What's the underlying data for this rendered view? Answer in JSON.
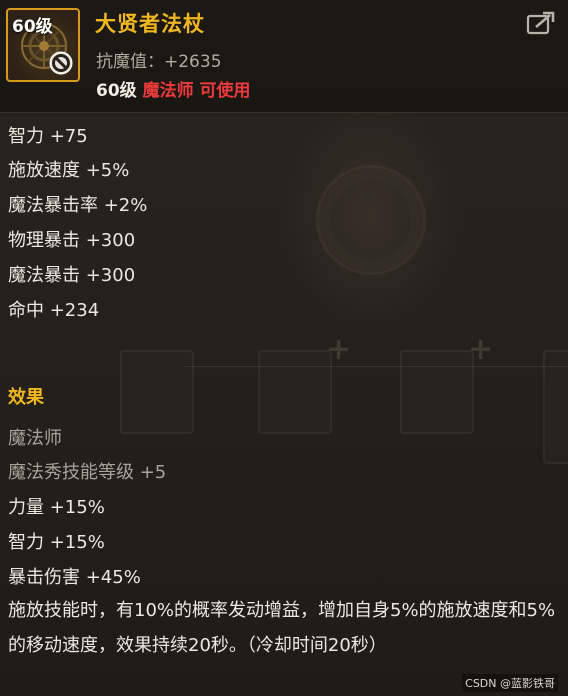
{
  "item": {
    "level_badge": "60级",
    "name": "大贤者法杖",
    "resist_label": "抗魔值：",
    "resist_value": "+2635",
    "req_level": "60级",
    "req_class": "魔法师 可使用"
  },
  "icons": {
    "share": "share-icon",
    "forbid": "forbid-icon"
  },
  "stats": [
    "智力 +75",
    "施放速度 +5%",
    "魔法暴击率 +2%",
    "物理暴击 +300",
    "魔法暴击 +300",
    "命中 +234"
  ],
  "effect": {
    "title": "效果",
    "class_name": "魔法师",
    "skill": "魔法秀技能等级 +5",
    "bonuses": [
      "力量 +15%",
      "智力 +15%",
      "暴击伤害 +45%"
    ],
    "description": "施放技能时，有10%的概率发动增益，增加自身5%的施放速度和5%的移动速度，效果持续20秒。（冷却时间20秒）"
  },
  "watermark": "CSDN @蓝影铁哥",
  "colors": {
    "gold": "#f2b71e",
    "red": "#ee3a3a",
    "text": "#ece7df",
    "gray": "#a9a39a"
  }
}
